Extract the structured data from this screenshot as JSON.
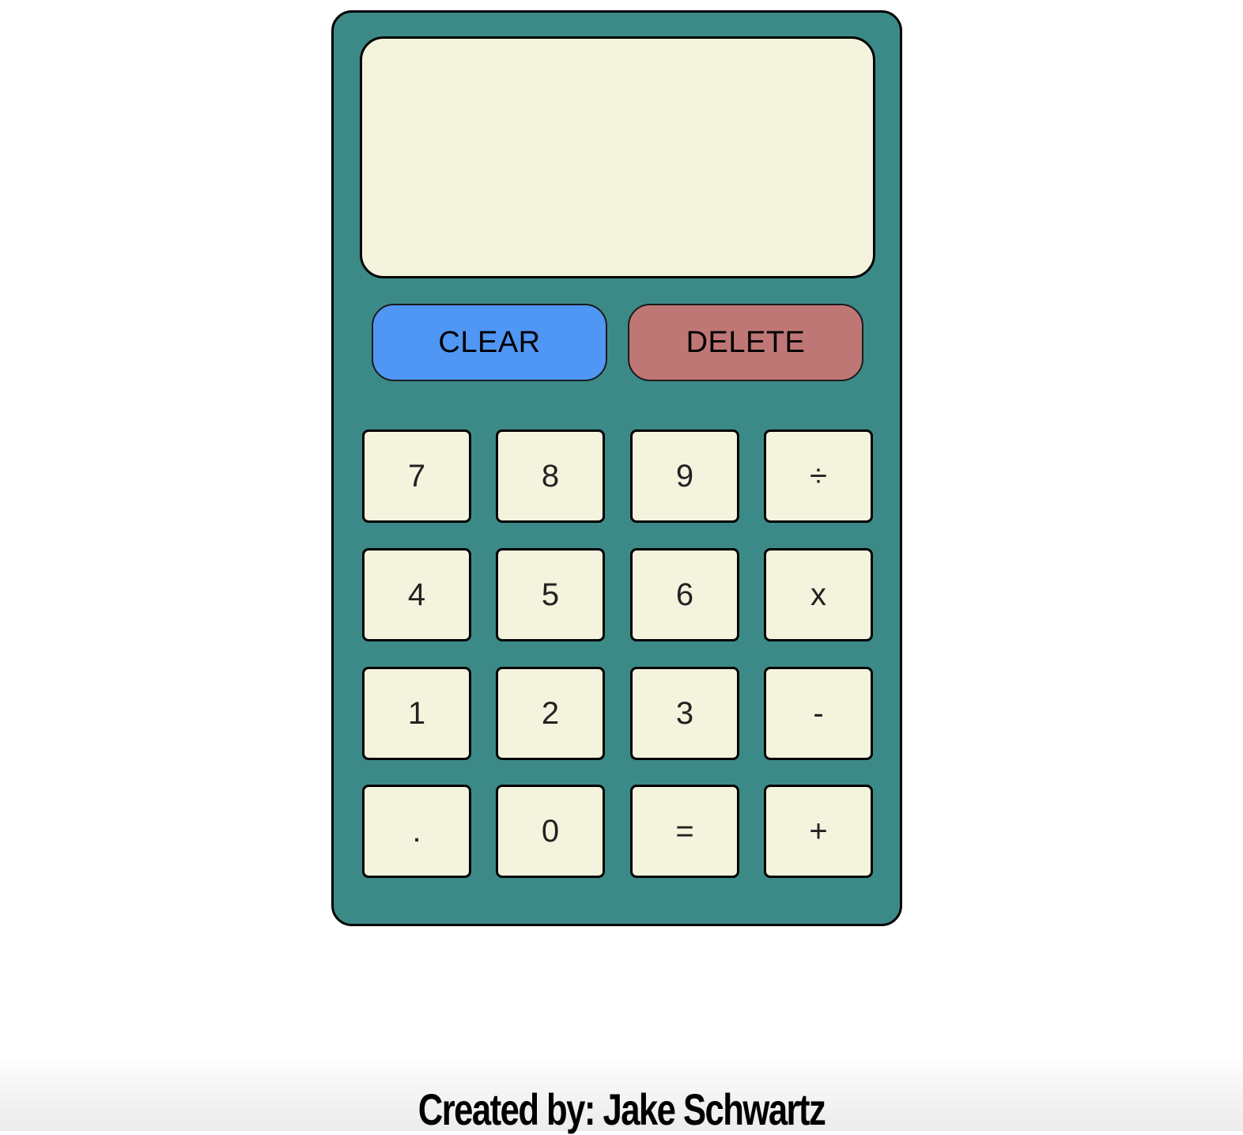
{
  "calculator": {
    "display": {
      "value": ""
    },
    "controls": {
      "clear_label": "CLEAR",
      "delete_label": "DELETE"
    },
    "keys": [
      {
        "label": "7",
        "name": "key-7"
      },
      {
        "label": "8",
        "name": "key-8"
      },
      {
        "label": "9",
        "name": "key-9"
      },
      {
        "label": "÷",
        "name": "key-divide"
      },
      {
        "label": "4",
        "name": "key-4"
      },
      {
        "label": "5",
        "name": "key-5"
      },
      {
        "label": "6",
        "name": "key-6"
      },
      {
        "label": "x",
        "name": "key-multiply"
      },
      {
        "label": "1",
        "name": "key-1"
      },
      {
        "label": "2",
        "name": "key-2"
      },
      {
        "label": "3",
        "name": "key-3"
      },
      {
        "label": "-",
        "name": "key-subtract"
      },
      {
        "label": ".",
        "name": "key-decimal"
      },
      {
        "label": "0",
        "name": "key-0"
      },
      {
        "label": "=",
        "name": "key-equals"
      },
      {
        "label": "+",
        "name": "key-add"
      }
    ]
  },
  "footer": {
    "credit": "Created by: Jake Schwartz"
  },
  "colors": {
    "body_bg": "#3c8a88",
    "screen_bg": "#f4f4de",
    "clear_bg": "#4f96f5",
    "delete_bg": "#bf7775",
    "key_bg": "#f4f4de",
    "border": "#000000"
  }
}
